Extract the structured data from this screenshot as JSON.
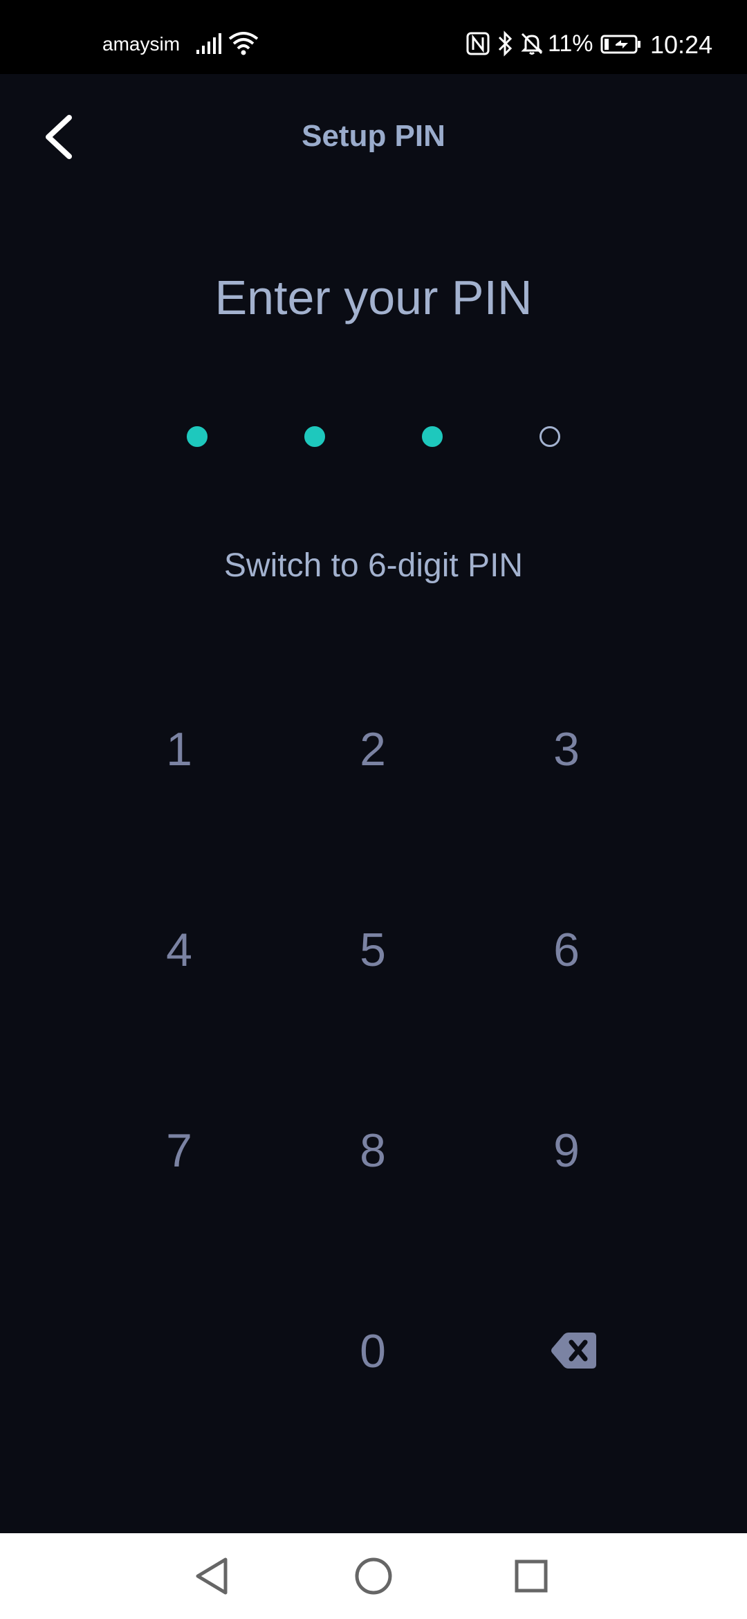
{
  "status_bar": {
    "carrier": "amaysim",
    "battery_percent": "11%",
    "time": "10:24",
    "icons": [
      "signal-icon",
      "wifi-icon",
      "nfc-icon",
      "bluetooth-icon",
      "bell-off-icon",
      "battery-charging-icon"
    ]
  },
  "header": {
    "title": "Setup PIN",
    "back_icon": "chevron-left-icon"
  },
  "prompt": "Enter your PIN",
  "pin": {
    "length": 4,
    "filled": 3,
    "filled_color": "#1ec8bd"
  },
  "switch_link": "Switch to 6-digit PIN",
  "keypad": {
    "keys": [
      "1",
      "2",
      "3",
      "4",
      "5",
      "6",
      "7",
      "8",
      "9",
      "0"
    ],
    "backspace_icon": "backspace-icon"
  },
  "nav_bar": {
    "icons": [
      "nav-back-icon",
      "nav-home-icon",
      "nav-recents-icon"
    ]
  },
  "colors": {
    "background": "#0a0c14",
    "accent": "#1ec8bd",
    "title": "#9aaccc",
    "key": "#7b83a3"
  }
}
